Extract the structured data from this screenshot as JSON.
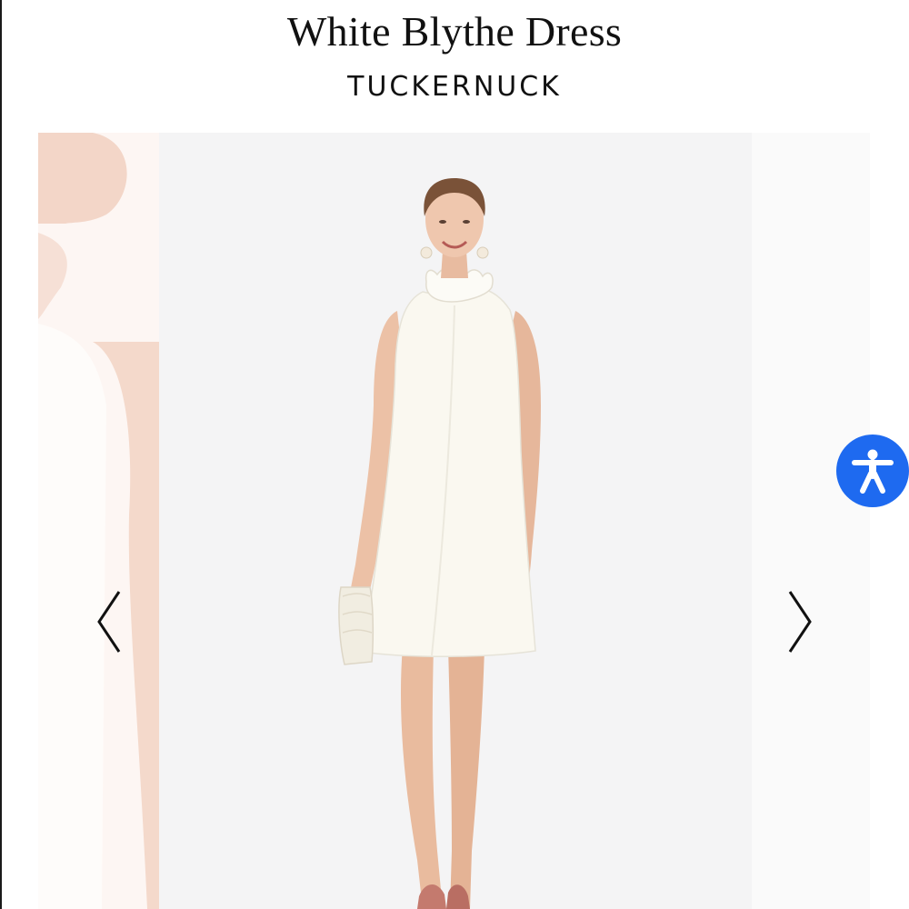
{
  "product": {
    "title": "White Blythe Dress",
    "brand": "TUCKERNUCK"
  },
  "gallery": {
    "main_image_alt": "Model wearing the white sleeveless ruffle-neck shift dress",
    "prev_icon": "chevron-left-icon",
    "next_icon": "chevron-right-icon"
  },
  "accessibility_widget": {
    "icon": "accessibility-person-icon",
    "color": "#1e6af0"
  },
  "colors": {
    "text": "#111111",
    "photo_background": "#f4f4f5",
    "dress": "#faf8f0",
    "skin": "#ecc1a6"
  }
}
